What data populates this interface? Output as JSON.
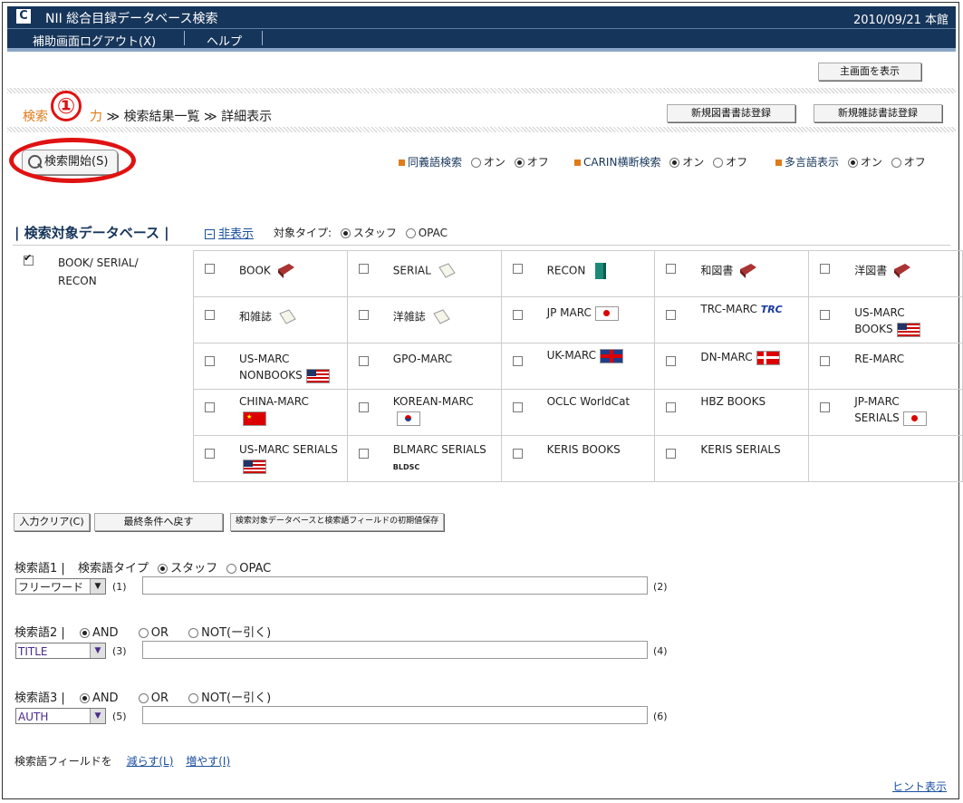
{
  "window": {
    "logo": "C",
    "title": "NII 総合目録データベース検索",
    "date": "2010/09/21 本館"
  },
  "menu": {
    "item1": "補助画面ログアウト(X)",
    "item2": "ヘルプ"
  },
  "main_screen_btn": "主画面を表示",
  "breadcrumb": {
    "step1": "検索",
    "step1b": "力",
    "sep": " ≫ ",
    "step2": "検索結果一覧",
    "step3": "詳細表示"
  },
  "new_book_btn": "新規図書書誌登録",
  "new_serial_btn": "新規雑誌書誌登録",
  "search_btn": "検索開始(S)",
  "annotation": "①",
  "options": {
    "synonym": "同義語検索",
    "carin": "CARIN横断検索",
    "multilang": "多言語表示",
    "on": "オン",
    "off": "オフ"
  },
  "db_section": {
    "title": "| 検索対象データベース |",
    "hide": "非表示",
    "target_type": "対象タイプ:",
    "staff": "スタッフ",
    "opac": "OPAC"
  },
  "db_left": {
    "line1": "BOOK/ SERIAL/",
    "line2": "RECON"
  },
  "db_items": [
    [
      "BOOK",
      "SERIAL",
      "RECON",
      "和図書",
      "洋図書"
    ],
    [
      "和雑誌",
      "洋雑誌",
      "JP MARC",
      "TRC-MARC",
      "US-MARC BOOKS"
    ],
    [
      "US-MARC NONBOOKS",
      "GPO-MARC",
      "UK-MARC",
      "DN-MARC",
      "RE-MARC"
    ],
    [
      "CHINA-MARC",
      "KOREAN-MARC",
      "OCLC WorldCat",
      "HBZ BOOKS",
      "JP-MARC SERIALS"
    ],
    [
      "US-MARC SERIALS",
      "BLMARC SERIALS",
      "KERIS BOOKS",
      "KERIS SERIALS",
      ""
    ]
  ],
  "trc_logo": "TRC",
  "bldsc_logo": "BLDSC",
  "actions": {
    "clear": "入力クリア(C)",
    "restore": "最終条件へ戻す",
    "save": "検索対象データベースと検索語フィールドの初期値保存"
  },
  "terms": [
    {
      "label": "検索語1 |",
      "type_label": "検索語タイプ",
      "staff": "スタッフ",
      "opac": "OPAC",
      "field": "フリーワード",
      "n1": "(1)",
      "n2": "(2)"
    },
    {
      "label": "検索語2 |",
      "and": "AND",
      "or": "OR",
      "not": "NOT(ー引く)",
      "field": "TITLE",
      "n1": "(3)",
      "n2": "(4)"
    },
    {
      "label": "検索語3 |",
      "and": "AND",
      "or": "OR",
      "not": "NOT(ー引く)",
      "field": "AUTH",
      "n1": "(5)",
      "n2": "(6)"
    }
  ],
  "field_ctrl": {
    "label": "検索語フィールドを",
    "reduce": "減らす(L)",
    "increase": "増やす(I)"
  },
  "hint": "ヒント表示"
}
